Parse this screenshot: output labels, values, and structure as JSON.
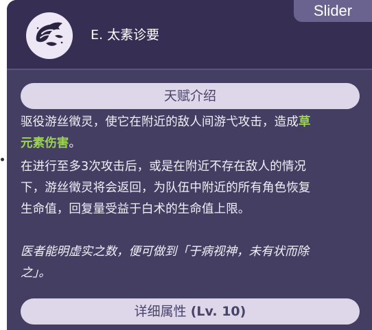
{
  "tab": {
    "label": "Slider"
  },
  "skill": {
    "icon": "dendro-lamp-icon",
    "name": "E. 太素诊要"
  },
  "talent_section": {
    "title": "天赋介绍",
    "para1": {
      "line1_text": "驱役游丝徵灵，使它在附近的敌人间游弋攻击，造成",
      "line1_highlight": "草",
      "line2_highlight": "元素伤害",
      "line2_end": "。"
    },
    "para2": {
      "line1": "在进行至多3次攻击后，或是在附近不存在敌人的情况",
      "line2": "下，游丝徵灵将会返回，为队伍中附近的所有角色恢复",
      "line3": "生命值，回复量受益于白术的生命值上限。"
    },
    "quote": {
      "line1": "医者能明虚实之数，便可做到「于病视神，未有状而除",
      "line2": "之」。"
    }
  },
  "detail_section": {
    "title": "详细属性",
    "level": "(Lv. 10)"
  },
  "colors": {
    "panel_bg": "#453e63",
    "header_bg": "#372f53",
    "pill_bg": "#ded7ea",
    "dendro_green": "#9bd44e"
  }
}
